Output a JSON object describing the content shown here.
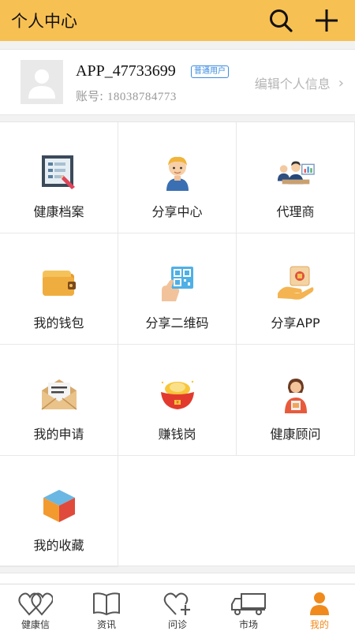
{
  "header": {
    "title": "个人中心",
    "search_icon": "search-icon",
    "add_icon": "plus-icon"
  },
  "profile": {
    "username": "APP_47733699",
    "badge": "普通用户",
    "account_label": "账号:",
    "account_number": "18038784773",
    "edit_label": "编辑个人信息",
    "chevron": "›"
  },
  "menu": [
    {
      "label": "健康档案",
      "icon": "health-record-icon"
    },
    {
      "label": "分享中心",
      "icon": "share-center-icon"
    },
    {
      "label": "代理商",
      "icon": "agent-icon"
    },
    {
      "label": "我的钱包",
      "icon": "wallet-icon"
    },
    {
      "label": "分享二维码",
      "icon": "qr-code-icon"
    },
    {
      "label": "分享APP",
      "icon": "share-app-icon"
    },
    {
      "label": "我的申请",
      "icon": "envelope-icon"
    },
    {
      "label": "赚钱岗",
      "icon": "gold-ingot-icon"
    },
    {
      "label": "健康顾问",
      "icon": "consultant-icon"
    },
    {
      "label": "我的收藏",
      "icon": "cube-icon"
    }
  ],
  "tabs": [
    {
      "label": "健康信",
      "icon": "hearts-icon",
      "active": false
    },
    {
      "label": "资讯",
      "icon": "book-icon",
      "active": false
    },
    {
      "label": "问诊",
      "icon": "heart-plus-icon",
      "active": false
    },
    {
      "label": "市场",
      "icon": "truck-icon",
      "active": false
    },
    {
      "label": "我的",
      "icon": "person-icon",
      "active": true
    }
  ],
  "colors": {
    "header_bg": "#f7c052",
    "active_tab": "#f08a1c",
    "badge": "#3c8de0"
  }
}
